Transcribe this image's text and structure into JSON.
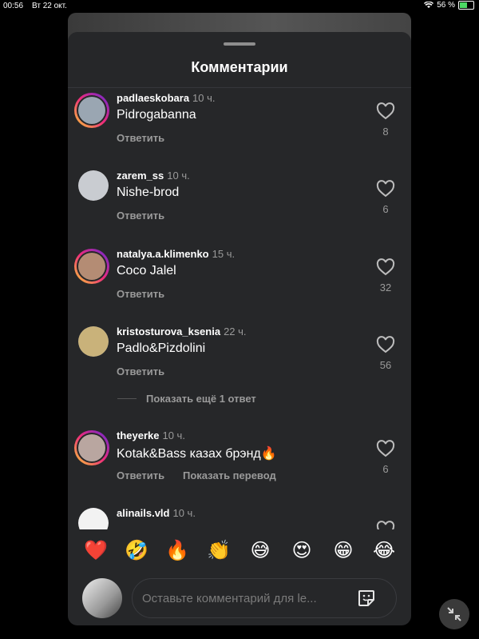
{
  "status_bar": {
    "time": "00:56",
    "date": "Вт 22 окт.",
    "battery": "56 %"
  },
  "sheet": {
    "title": "Комментарии"
  },
  "comments": [
    {
      "username": "padlaeskobara",
      "time": "10 ч.",
      "text": "Pidrogabanna",
      "likes": "8",
      "reply_label": "Ответить",
      "avatar_color": "#9aa6b2"
    },
    {
      "username": "zarem_ss",
      "time": "10 ч.",
      "text": "Nishe-brod",
      "likes": "6",
      "reply_label": "Ответить",
      "avatar_color": "#c9ccd1"
    },
    {
      "username": "natalya.a.klimenko",
      "time": "15 ч.",
      "text": "Coco Jalel",
      "likes": "32",
      "reply_label": "Ответить",
      "avatar_color": "#b48c74"
    },
    {
      "username": "kristosturova_ksenia",
      "time": "22 ч.",
      "text": "Padlo&Pizdolini",
      "likes": "56",
      "reply_label": "Ответить",
      "avatar_color": "#c9b27a"
    },
    {
      "username": "theyerke",
      "time": "10 ч.",
      "text": "Kotak&Bass  казах брэнд🔥",
      "likes": "6",
      "reply_label": "Ответить",
      "translate_label": "Показать перевод",
      "avatar_color": "#b9a6a0"
    },
    {
      "username": "alinails.vld",
      "time": "10 ч.",
      "avatar_color": "#f2f2f2"
    }
  ],
  "more_replies": "Показать ещё 1 ответ",
  "emoji_bar": [
    "❤️",
    "🤣",
    "🔥",
    "👏",
    "😅",
    "😍",
    "😁",
    "😂"
  ],
  "comment_input": {
    "placeholder": "Оставьте комментарий для le..."
  },
  "icons": {
    "like": "heart-icon",
    "sticker": "sticker-icon",
    "collapse": "collapse-arrows-icon",
    "wifi": "wifi-icon",
    "battery": "battery-icon"
  },
  "colors": {
    "sheet_bg": "#262729",
    "secondary_text": "#9a9a9a",
    "background": "#000000"
  }
}
